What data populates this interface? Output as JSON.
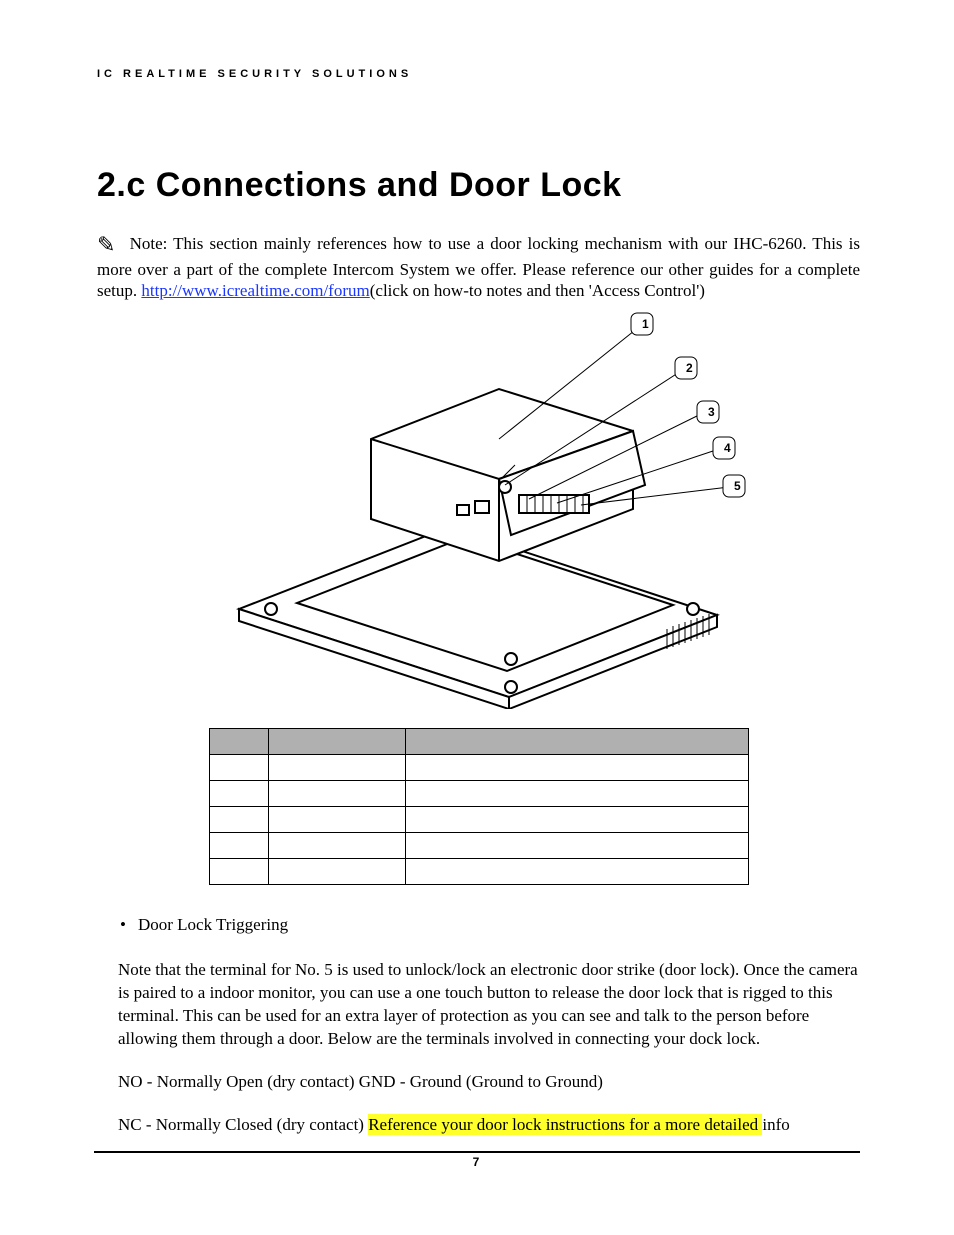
{
  "header": {
    "running": "IC REALTIME SECURITY SOLUTIONS"
  },
  "title": "2.c Connections and Door Lock",
  "note": {
    "pre": "Note: This section mainly references how to use a door locking mechanism with our IHC-6260. This is more over a part of the complete Intercom System we offer. Please reference our other guides for a complete setup.  ",
    "link_text": "http://www.icrealtime.com/forum",
    "post": "(click on how-to notes and then 'Access Control')"
  },
  "diagram": {
    "callouts": [
      "1",
      "2",
      "3",
      "4",
      "5"
    ]
  },
  "table": {
    "headers": [
      "",
      "",
      ""
    ],
    "rows": [
      [
        "",
        "",
        ""
      ],
      [
        "",
        "",
        ""
      ],
      [
        "",
        "",
        ""
      ],
      [
        "",
        "",
        ""
      ],
      [
        "",
        "",
        ""
      ]
    ]
  },
  "body": {
    "bullet": "Door Lock Triggering",
    "para1": "Note that the terminal for No. 5 is used to unlock/lock an electronic door strike (door lock). Once the camera is paired to a indoor monitor, you can use a one touch button to release the door lock that is rigged to this terminal. This can be used for an extra layer of protection as you can see and talk to the person before allowing them through a door. Below are the terminals involved in connecting your dock lock.",
    "line_no": "NO - Normally Open (dry contact) GND - Ground (Ground to Ground)",
    "line_nc_a": "NC - Normally Closed (dry contact)  ",
    "line_nc_hl": " Reference your door lock instructions for a more detailed ",
    "line_nc_b": " info"
  },
  "footer": {
    "page_number": "7"
  }
}
